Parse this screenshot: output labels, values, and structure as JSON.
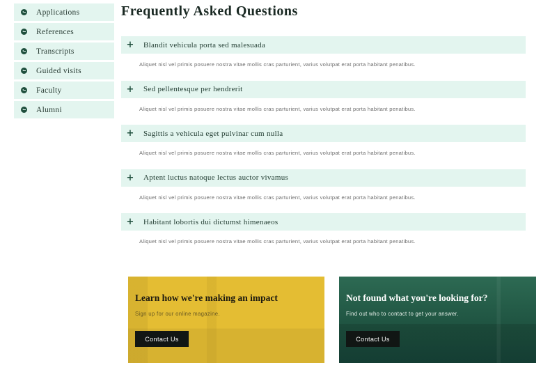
{
  "sidebar": {
    "items": [
      {
        "label": "Applications",
        "icon": "arrow-circle-left-icon"
      },
      {
        "label": "References",
        "icon": "arrow-circle-left-icon"
      },
      {
        "label": "Transcripts",
        "icon": "arrow-circle-left-icon"
      },
      {
        "label": "Guided visits",
        "icon": "arrow-circle-left-icon"
      },
      {
        "label": "Faculty",
        "icon": "arrow-circle-left-icon"
      },
      {
        "label": "Alumni",
        "icon": "arrow-circle-left-icon"
      }
    ]
  },
  "main": {
    "title": "Frequently Asked Questions",
    "faq": [
      {
        "icon": "+",
        "question": "Blandit vehicula porta sed malesuada",
        "answer": "Aliquet nisl vel primis posuere nostra vitae mollis cras parturient, varius volutpat erat porta habitant penatibus."
      },
      {
        "icon": "+",
        "question": "Sed pellentesque per hendrerit",
        "answer": "Aliquet nisl vel primis posuere nostra vitae mollis cras parturient, varius volutpat erat porta habitant penatibus."
      },
      {
        "icon": "+",
        "question": "Sagittis a vehicula eget pulvinar cum nulla",
        "answer": "Aliquet nisl vel primis posuere nostra vitae mollis cras parturient, varius volutpat erat porta habitant penatibus."
      },
      {
        "icon": "+",
        "question": "Aptent luctus natoque lectus auctor vivamus",
        "answer": "Aliquet nisl vel primis posuere nostra vitae mollis cras parturient, varius volutpat erat porta habitant penatibus."
      },
      {
        "icon": "+",
        "question": "Habitant lobortis dui dictumst himenaeos",
        "answer": "Aliquet nisl vel primis posuere nostra vitae mollis cras parturient, varius volutpat erat porta habitant penatibus."
      }
    ]
  },
  "cards": [
    {
      "title": "Learn how we're making an impact",
      "subtitle": "Sign up for our online magazine.",
      "button": "Contact Us",
      "color": "#e4bd33"
    },
    {
      "title": "Not found what you're looking for?",
      "subtitle": "Find out who to contact to get your answer.",
      "button": "Contact Us",
      "color": "#1e5240"
    }
  ],
  "colors": {
    "accent_light": "#e3f5ef",
    "accent_dark": "#1f4f3d"
  }
}
